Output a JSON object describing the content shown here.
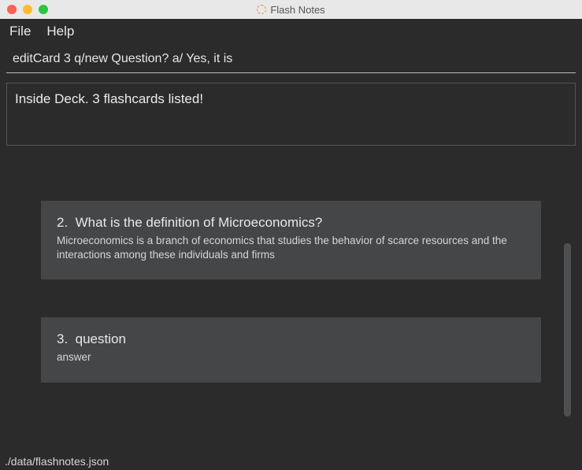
{
  "window": {
    "title": "Flash Notes"
  },
  "menu": {
    "file": "File",
    "help": "Help"
  },
  "command": {
    "value": "editCard 3 q/new Question? a/ Yes, it is"
  },
  "status": {
    "text": "Inside Deck. 3 flashcards listed!"
  },
  "cards": [
    {
      "num": "2.",
      "question": "What is the definition of Microeconomics?",
      "answer": "Microeconomics is a branch of economics that studies the behavior of scarce resources and the interactions among these individuals and firms"
    },
    {
      "num": "3.",
      "question": "question",
      "answer": "answer"
    }
  ],
  "footer": {
    "path": "./data/flashnotes.json"
  }
}
